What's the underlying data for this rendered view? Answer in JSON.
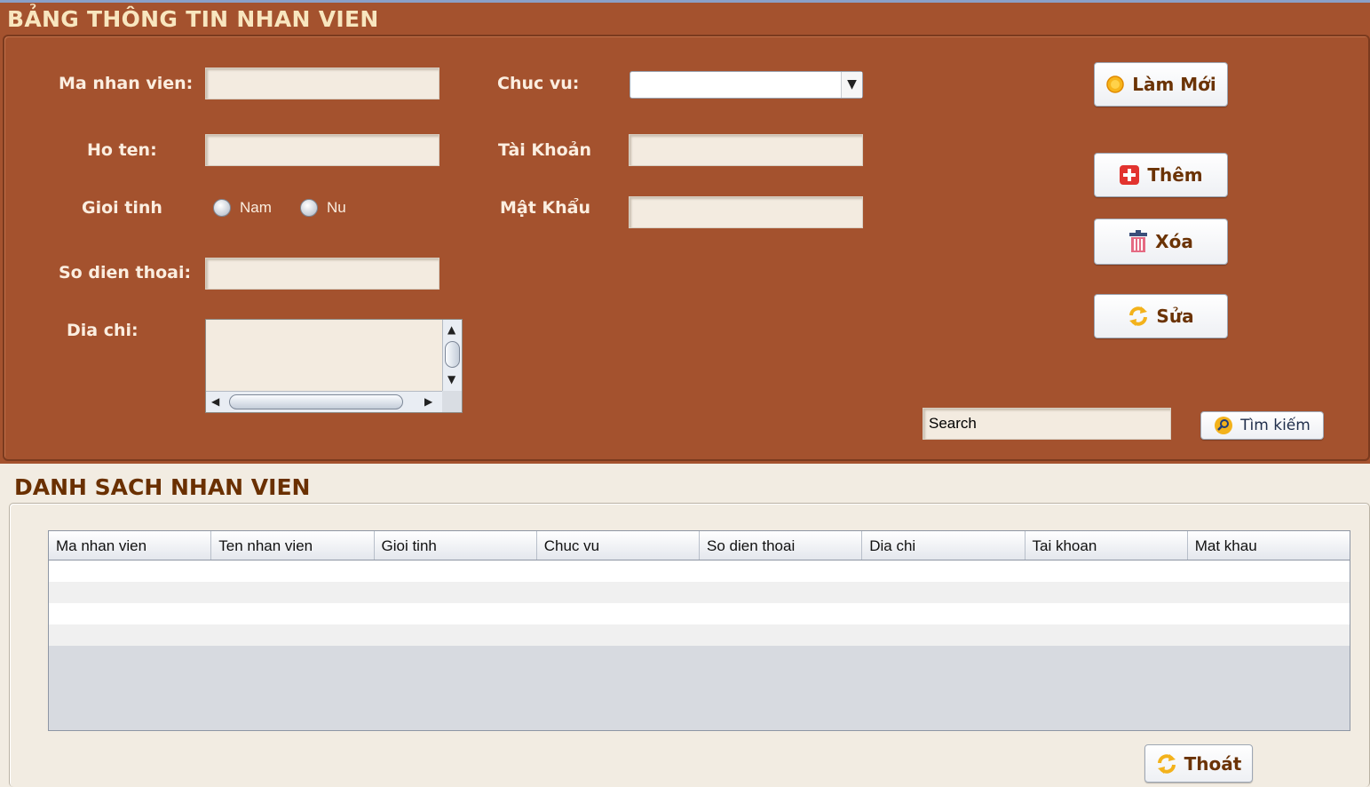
{
  "form": {
    "title": "BẢNG THÔNG TIN NHAN VIEN",
    "labels": {
      "ma_nhan_vien": "Ma nhan vien:",
      "ho_ten": "Ho ten:",
      "gioi_tinh": "Gioi tinh",
      "so_dien_thoai": "So dien thoai:",
      "dia_chi": "Dia chi:",
      "chuc_vu": "Chuc vu:",
      "tai_khoan": "Tài Khoản",
      "mat_khau": "Mật Khẩu"
    },
    "values": {
      "ma_nhan_vien": "",
      "ho_ten": "",
      "so_dien_thoai": "",
      "dia_chi": "",
      "chuc_vu": "",
      "tai_khoan": "",
      "mat_khau": ""
    },
    "gender_options": [
      "Nam",
      "Nu"
    ],
    "buttons": {
      "lam_moi": "Làm Mới",
      "them": "Thêm",
      "xoa": "Xóa",
      "sua": "Sửa",
      "tim_kiem": "Tìm kiếm"
    },
    "search_value": "Search"
  },
  "list": {
    "title": "DANH SACH NHAN VIEN",
    "columns": [
      "Ma nhan vien",
      "Ten nhan vien",
      "Gioi tinh",
      "Chuc vu",
      "So dien thoai",
      "Dia chi",
      "Tai khoan",
      "Mat khau"
    ],
    "rows": []
  },
  "exit_button": "Thoát",
  "colors": {
    "panel_bg": "#a4522e",
    "panel_title": "#f8e6bf",
    "bottom_bg": "#f2ece2",
    "bottom_title": "#6a3000",
    "button_text": "#6b3305"
  },
  "icons": {
    "lam_moi": "sun-icon",
    "them": "plus-icon",
    "xoa": "trash-icon",
    "sua": "refresh-icon",
    "tim_kiem": "magnifier-icon",
    "thoat": "refresh-icon"
  }
}
